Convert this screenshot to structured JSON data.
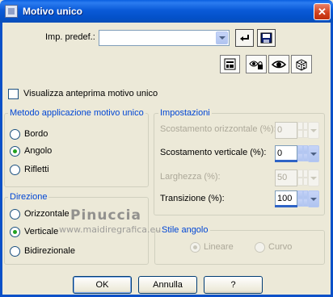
{
  "window": {
    "title": "Motivo unico",
    "close_glyph": "✕",
    "icon": "app-icon"
  },
  "preset": {
    "label": "Imp. predef.:",
    "value": "",
    "icons": [
      "reset-icon",
      "save-icon"
    ]
  },
  "toolbar": {
    "icons": [
      "preview-panel-icon",
      "eye-lock-icon",
      "eye-icon",
      "dice-icon"
    ]
  },
  "preview_checkbox": {
    "label": "Visualizza anteprima motivo unico",
    "checked": false
  },
  "method": {
    "legend": "Metodo applicazione motivo unico",
    "options": [
      "Bordo",
      "Angolo",
      "Rifletti"
    ],
    "selected": "Angolo"
  },
  "settings": {
    "legend": "Impostazioni",
    "fields": [
      {
        "label": "Scostamento orizzontale (%):",
        "value": "0",
        "enabled": false
      },
      {
        "label": "Scostamento verticale (%):",
        "value": "0",
        "enabled": true
      },
      {
        "label": "Larghezza (%):",
        "value": "50",
        "enabled": false
      },
      {
        "label": "Transizione (%):",
        "value": "100",
        "enabled": true
      }
    ]
  },
  "direction": {
    "legend": "Direzione",
    "options": [
      "Orizzontale",
      "Verticale",
      "Bidirezionale"
    ],
    "selected": "Verticale"
  },
  "corner_style": {
    "legend": "Stile angolo",
    "options": [
      "Lineare",
      "Curvo"
    ],
    "selected": "Lineare",
    "enabled": false
  },
  "buttons": {
    "ok": "OK",
    "cancel": "Annulla",
    "help": "?"
  },
  "watermark": {
    "name": "Pinuccia",
    "url": "www.maidiregrafica.eu"
  },
  "colors": {
    "title_bar": "#0a5ad8",
    "legend_text": "#0046d5",
    "dialog_bg": "#ece9d8",
    "spin_bar": "#2e63c6"
  }
}
